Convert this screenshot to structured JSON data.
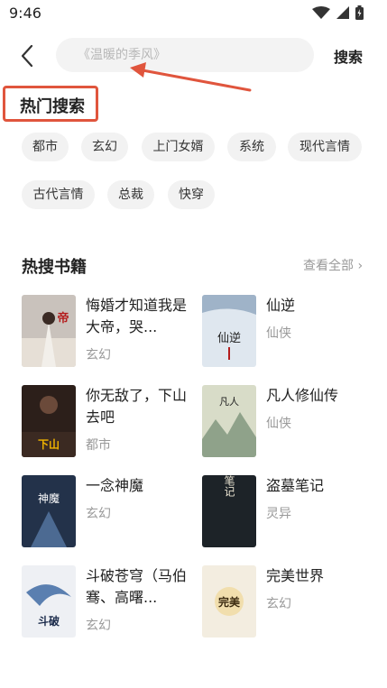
{
  "status": {
    "time": "9:46"
  },
  "header": {
    "search_placeholder": "《温暖的季风》",
    "search_label": "搜索"
  },
  "hot_search": {
    "title": "热门搜索",
    "tags": [
      "都市",
      "玄幻",
      "上门女婿",
      "系统",
      "现代言情",
      "古代言情",
      "总裁",
      "快穿"
    ]
  },
  "hot_books": {
    "title": "热搜书籍",
    "view_all": "查看全部",
    "books": [
      {
        "title": "悔婚才知道我是大帝，哭...",
        "genre": "玄幻",
        "cover_color": "#c9c2bc",
        "cover_text": "帝"
      },
      {
        "title": "仙逆",
        "genre": "仙侠",
        "cover_color": "#dfe7ef",
        "cover_text": "仙逆"
      },
      {
        "title": "你无敌了，下山去吧",
        "genre": "都市",
        "cover_color": "#2c1f1a",
        "cover_text": "下山"
      },
      {
        "title": "凡人修仙传",
        "genre": "仙侠",
        "cover_color": "#d8dcc8",
        "cover_text": "凡人"
      },
      {
        "title": "一念神魔",
        "genre": "玄幻",
        "cover_color": "#23324a",
        "cover_text": "神魔"
      },
      {
        "title": "盗墓笔记",
        "genre": "灵异",
        "cover_color": "#1d2328",
        "cover_text": "盗墓笔记"
      },
      {
        "title": "斗破苍穹（马伯骞、高曙...",
        "genre": "玄幻",
        "cover_color": "#eef0f4",
        "cover_text": "斗破"
      },
      {
        "title": "完美世界",
        "genre": "玄幻",
        "cover_color": "#f3ede0",
        "cover_text": "完美"
      }
    ]
  },
  "colors": {
    "annotation": "#e0553d"
  }
}
